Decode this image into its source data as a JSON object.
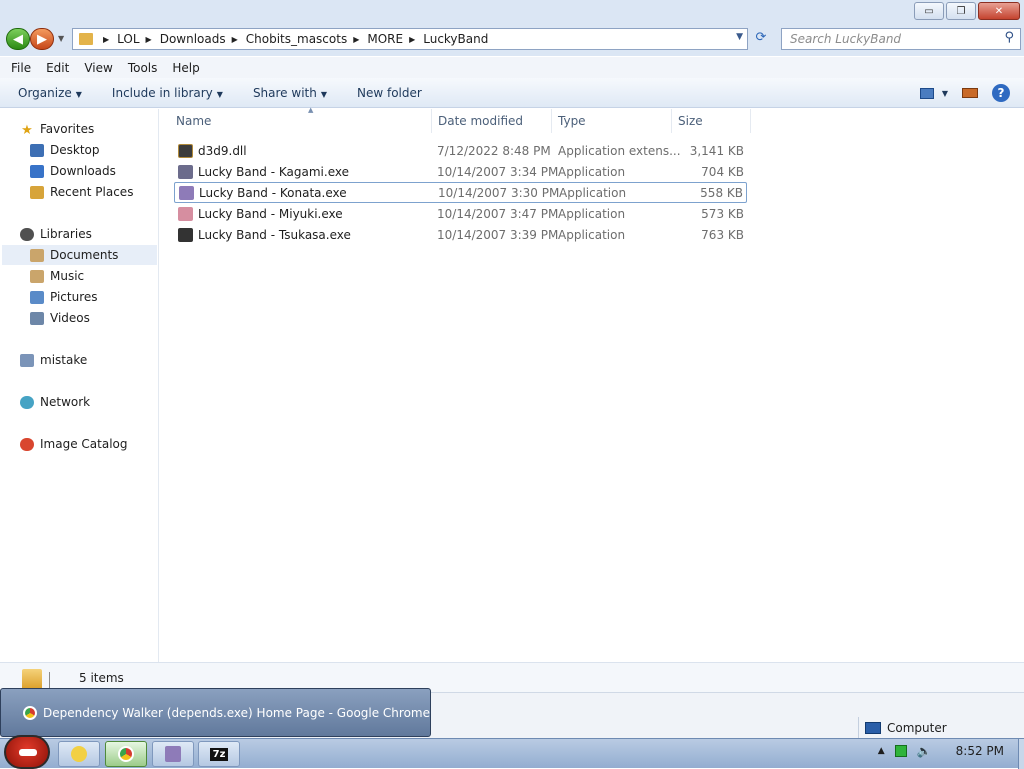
{
  "window": {
    "minimize": "▭",
    "restore": "❐",
    "close": "✕"
  },
  "address": {
    "crumbs": [
      "LOL",
      "Downloads",
      "Chobits_mascots",
      "MORE",
      "LuckyBand"
    ],
    "search_placeholder": "Search LuckyBand"
  },
  "menu": [
    "File",
    "Edit",
    "View",
    "Tools",
    "Help"
  ],
  "commands": {
    "organize": "Organize",
    "include_in_library": "Include in library",
    "share_with": "Share with",
    "new_folder": "New folder"
  },
  "nav": {
    "favorites": "Favorites",
    "desktop": "Desktop",
    "downloads": "Downloads",
    "recent_places": "Recent Places",
    "libraries": "Libraries",
    "documents": "Documents",
    "music": "Music",
    "pictures": "Pictures",
    "videos": "Videos",
    "mistake": "mistake",
    "network": "Network",
    "image_catalog": "Image Catalog"
  },
  "columns": {
    "name": "Name",
    "date": "Date modified",
    "type": "Type",
    "size": "Size"
  },
  "files": [
    {
      "name": "d3d9.dll",
      "date": "7/12/2022 8:48 PM",
      "type": "Application extens...",
      "size": "3,141 KB",
      "icon": "dll-file-icon"
    },
    {
      "name": "Lucky Band - Kagami.exe",
      "date": "10/14/2007 3:34 PM",
      "type": "Application",
      "size": "704 KB",
      "icon": "kagami-app-icon"
    },
    {
      "name": "Lucky Band - Konata.exe",
      "date": "10/14/2007 3:30 PM",
      "type": "Application",
      "size": "558 KB",
      "icon": "konata-app-icon"
    },
    {
      "name": "Lucky Band - Miyuki.exe",
      "date": "10/14/2007 3:47 PM",
      "type": "Application",
      "size": "573 KB",
      "icon": "miyuki-app-icon"
    },
    {
      "name": "Lucky Band - Tsukasa.exe",
      "date": "10/14/2007 3:39 PM",
      "type": "Application",
      "size": "763 KB",
      "icon": "tsukasa-app-icon"
    }
  ],
  "status": {
    "item_count": "5 items",
    "zone": "Computer"
  },
  "thumbnail": {
    "title": "Dependency Walker (depends.exe) Home Page - Google Chrome"
  },
  "taskbar": {
    "seven_zip": "7z",
    "clock": "8:52 PM"
  },
  "colors": {
    "accent": "#dbe6f4",
    "selection": "#e7eef8",
    "focus_border": "#7da2ce"
  }
}
